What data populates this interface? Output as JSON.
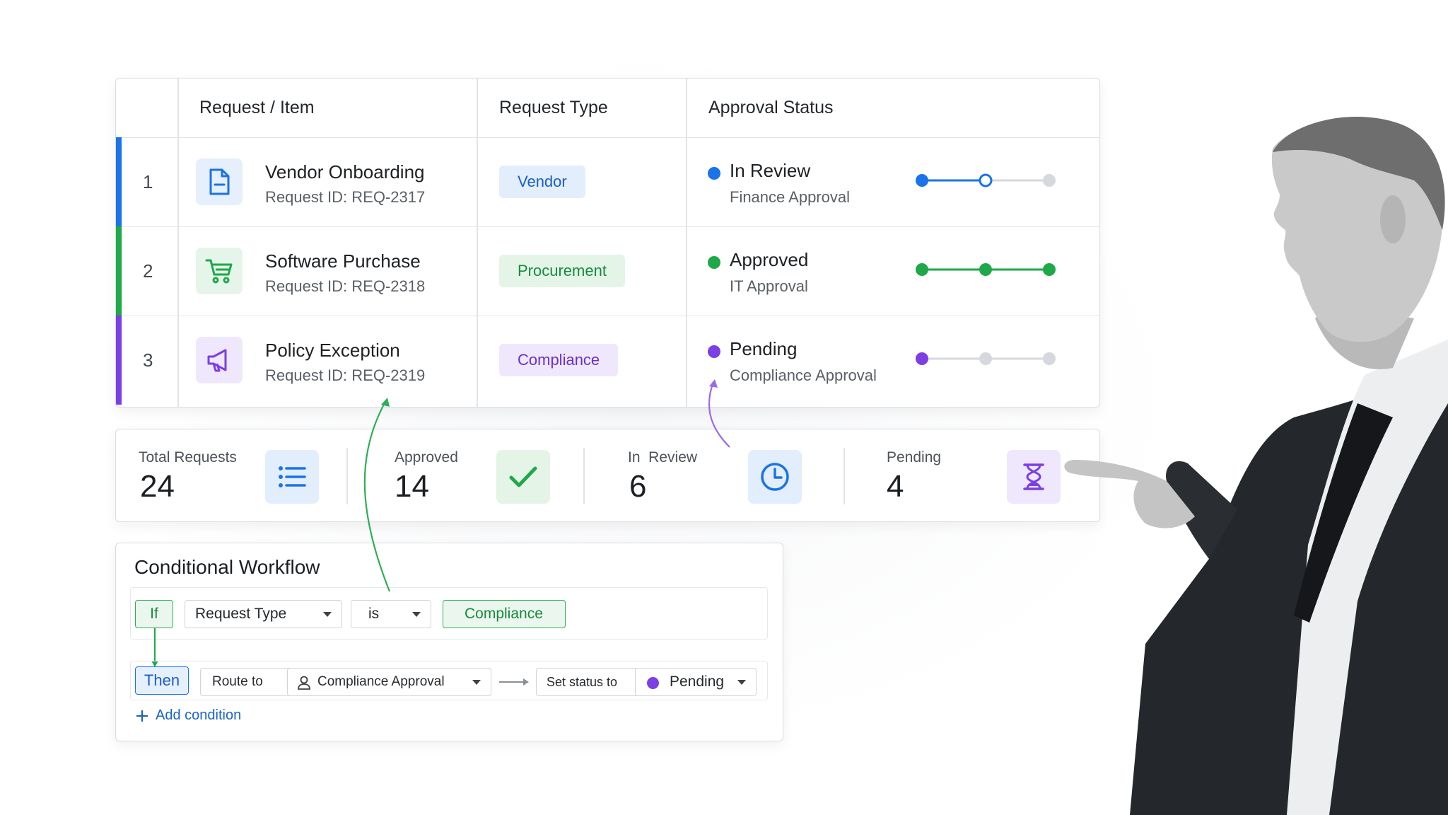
{
  "table": {
    "headers": {
      "request_item": "Request / Item",
      "request_type": "Request Type",
      "approval_status": "Approval Status"
    },
    "rows": [
      {
        "num": "1",
        "title": "Vendor Onboarding",
        "request_id": "Request ID: REQ-2317",
        "type": "Vendor",
        "status": "In Review",
        "stage": "Finance Approval",
        "accent": "#1a73e8",
        "icon": "document-icon"
      },
      {
        "num": "2",
        "title": "Software Purchase",
        "request_id": "Request ID: REQ-2318",
        "type": "Procurement",
        "status": "Approved",
        "stage": "IT Approval",
        "accent": "#1fa84a",
        "icon": "cart-icon"
      },
      {
        "num": "3",
        "title": "Policy Exception",
        "request_id": "Request ID: REQ-2319",
        "type": "Compliance",
        "status": "Pending",
        "stage": "Compliance Approval",
        "accent": "#7b3fe4",
        "icon": "megaphone-icon"
      }
    ]
  },
  "stats": [
    {
      "label": "Total Requests",
      "value": "24",
      "icon": "list-icon"
    },
    {
      "label": "Approved",
      "value": "14",
      "icon": "check-icon"
    },
    {
      "label": "In  Review",
      "value": "6",
      "icon": "clock-icon"
    },
    {
      "label": "Pending",
      "value": "4",
      "icon": "hourglass-icon"
    }
  ],
  "workflow": {
    "title": "Conditional Workflow",
    "if_label": "If",
    "field": "Request Type",
    "operator": "is",
    "value": "Compliance",
    "then_label": "Then",
    "route_label": "Route to",
    "route_target": "Compliance Approval",
    "set_status_label": "Set status to",
    "status_value": "Pending",
    "add_condition": "Add condition"
  },
  "colors": {
    "blue": "#1a73e8",
    "green": "#1fa84a",
    "purple": "#7b3fe4"
  }
}
